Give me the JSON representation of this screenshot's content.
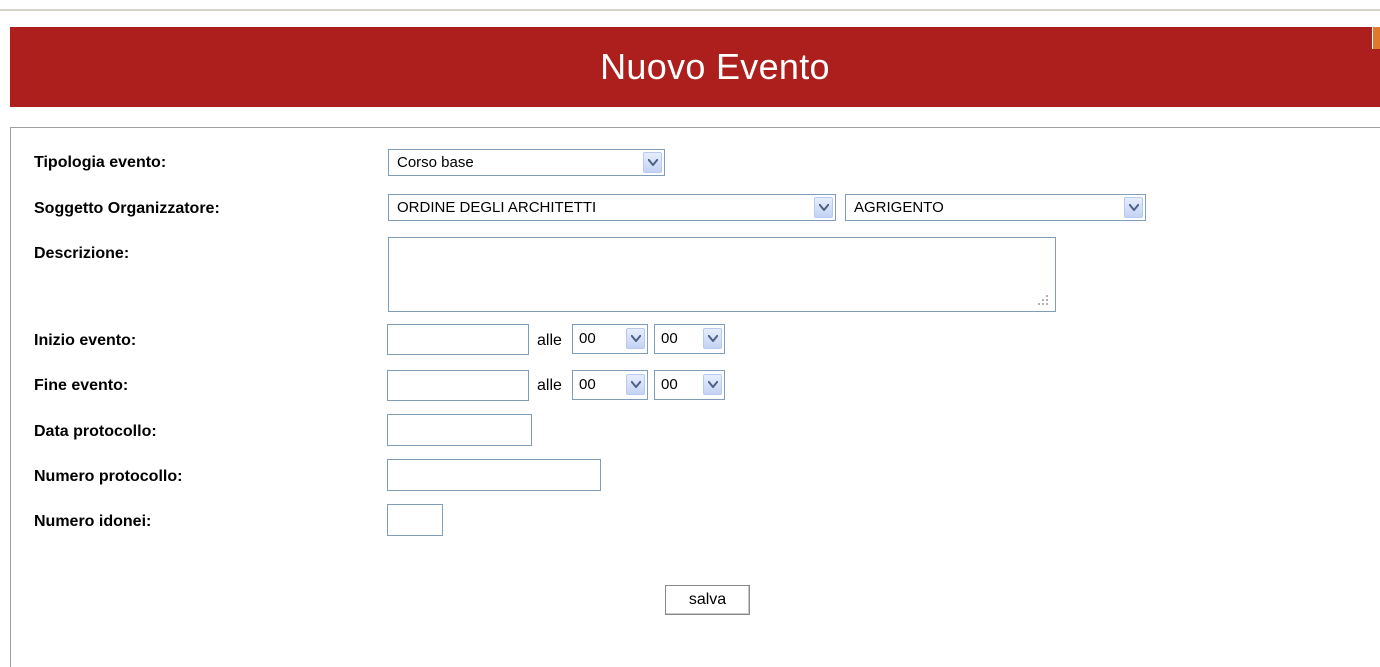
{
  "dialog": {
    "title": "Nuovo Evento"
  },
  "form": {
    "tipologia": {
      "label": "Tipologia evento:",
      "value": "Corso base"
    },
    "soggetto": {
      "label": "Soggetto Organizzatore:",
      "value": "ORDINE DEGLI ARCHITETTI",
      "province_value": "AGRIGENTO"
    },
    "descrizione": {
      "label": "Descrizione:",
      "value": ""
    },
    "inizio": {
      "label": "Inizio evento:",
      "date_value": "",
      "alle": "alle",
      "hour": "00",
      "minute": "00"
    },
    "fine": {
      "label": "Fine evento:",
      "date_value": "",
      "alle": "alle",
      "hour": "00",
      "minute": "00"
    },
    "data_protocollo": {
      "label": "Data protocollo:",
      "value": ""
    },
    "numero_protocollo": {
      "label": "Numero protocollo:",
      "value": ""
    },
    "numero_idonei": {
      "label": "Numero idonei:",
      "value": ""
    },
    "save_label": "salva"
  },
  "colors": {
    "banner": "#ac1f1c",
    "accent_close": "#e07a2a",
    "field_border": "#7f9db9"
  },
  "icons": {
    "close": "close-icon",
    "dropdown": "chevron-down-icon",
    "resize": "resize-grip-icon"
  }
}
